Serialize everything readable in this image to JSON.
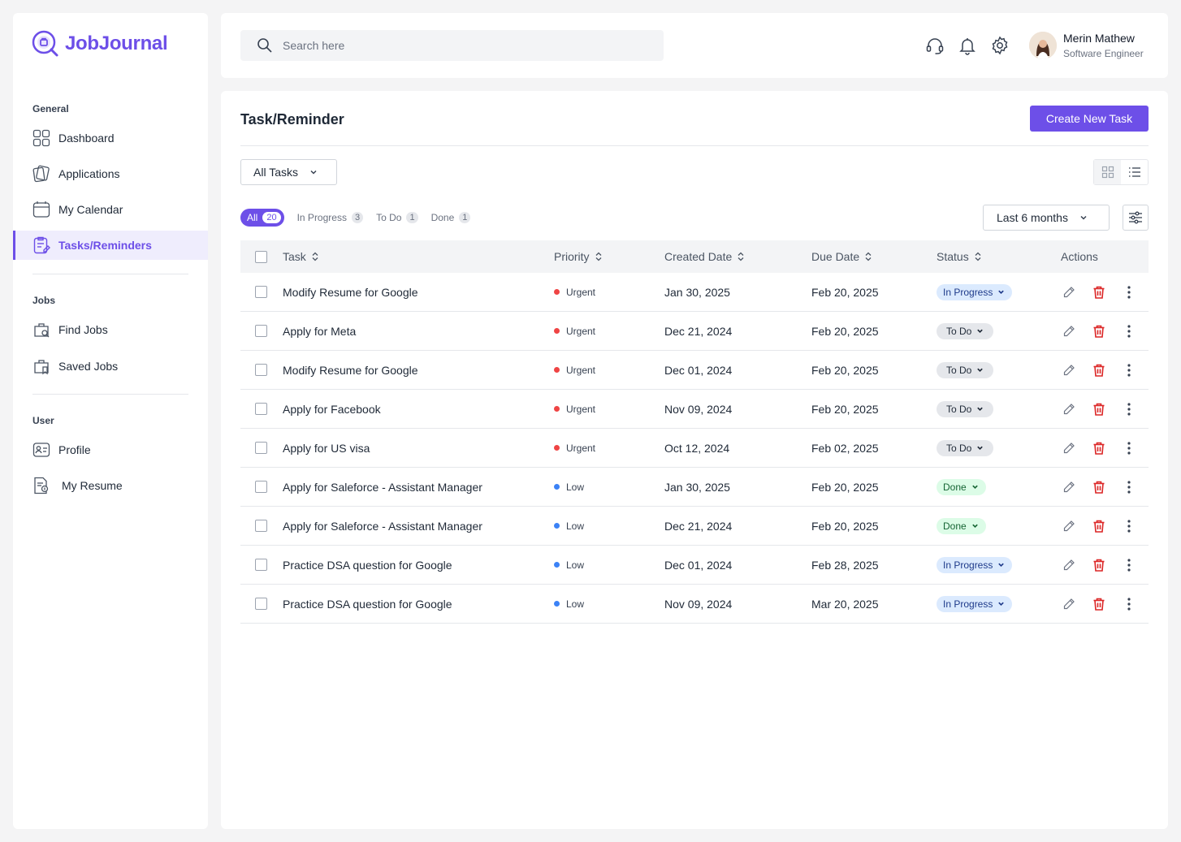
{
  "app": {
    "name": "JobJournal"
  },
  "sidebar": {
    "sections": [
      {
        "title": "General"
      },
      {
        "title": "Jobs"
      },
      {
        "title": "User"
      }
    ],
    "items": [
      {
        "label": "Dashboard",
        "icon": "dashboard-icon"
      },
      {
        "label": "Applications",
        "icon": "applications-icon"
      },
      {
        "label": "My Calendar",
        "icon": "calendar-icon"
      },
      {
        "label": "Tasks/Reminders",
        "icon": "tasks-icon",
        "active": true
      },
      {
        "label": "Find Jobs",
        "icon": "find-jobs-icon"
      },
      {
        "label": "Saved Jobs",
        "icon": "saved-jobs-icon"
      },
      {
        "label": "Profile",
        "icon": "profile-icon"
      },
      {
        "label": "My Resume",
        "icon": "resume-icon"
      }
    ]
  },
  "header": {
    "search_placeholder": "Search here",
    "user": {
      "name": "Merin Mathew",
      "role": "Software Engineer"
    }
  },
  "main": {
    "title": "Task/Reminder",
    "create_button": "Create New Task",
    "filter_dropdown": "All Tasks",
    "date_range": "Last 6 months",
    "tabs": [
      {
        "label": "All",
        "count": "20",
        "active": true
      },
      {
        "label": "In Progress",
        "count": "3"
      },
      {
        "label": "To Do",
        "count": "1"
      },
      {
        "label": "Done",
        "count": "1"
      }
    ],
    "columns": {
      "task": "Task",
      "priority": "Priority",
      "created": "Created Date",
      "due": "Due Date",
      "status": "Status",
      "actions": "Actions"
    },
    "rows": [
      {
        "task": "Modify Resume for Google",
        "priority": "Urgent",
        "created": "Jan 30, 2025",
        "due": "Feb 20, 2025",
        "status": "In Progress"
      },
      {
        "task": "Apply for Meta",
        "priority": "Urgent",
        "created": "Dec 21, 2024",
        "due": "Feb 20, 2025",
        "status": "To Do"
      },
      {
        "task": "Modify Resume for Google",
        "priority": "Urgent",
        "created": "Dec 01, 2024",
        "due": "Feb 20, 2025",
        "status": "To Do"
      },
      {
        "task": "Apply for Facebook",
        "priority": "Urgent",
        "created": "Nov 09, 2024",
        "due": "Feb 20, 2025",
        "status": "To Do"
      },
      {
        "task": "Apply for US visa",
        "priority": "Urgent",
        "created": "Oct 12, 2024",
        "due": "Feb 02, 2025",
        "status": "To Do"
      },
      {
        "task": "Apply for Saleforce - Assistant Manager",
        "priority": "Low",
        "created": "Jan 30, 2025",
        "due": "Feb 20, 2025",
        "status": "Done"
      },
      {
        "task": "Apply for Saleforce - Assistant Manager",
        "priority": "Low",
        "created": "Dec 21, 2024",
        "due": "Feb 20, 2025",
        "status": "Done"
      },
      {
        "task": "Practice DSA question for Google",
        "priority": "Low",
        "created": "Dec 01, 2024",
        "due": "Feb 28, 2025",
        "status": "In Progress"
      },
      {
        "task": "Practice DSA question for Google",
        "priority": "Low",
        "created": "Nov 09, 2024",
        "due": "Mar 20, 2025",
        "status": "In Progress"
      }
    ]
  },
  "colors": {
    "accent": "#6d4fe8",
    "urgent": "#ef4444",
    "low": "#3b82f6",
    "delete": "#dc2626"
  }
}
